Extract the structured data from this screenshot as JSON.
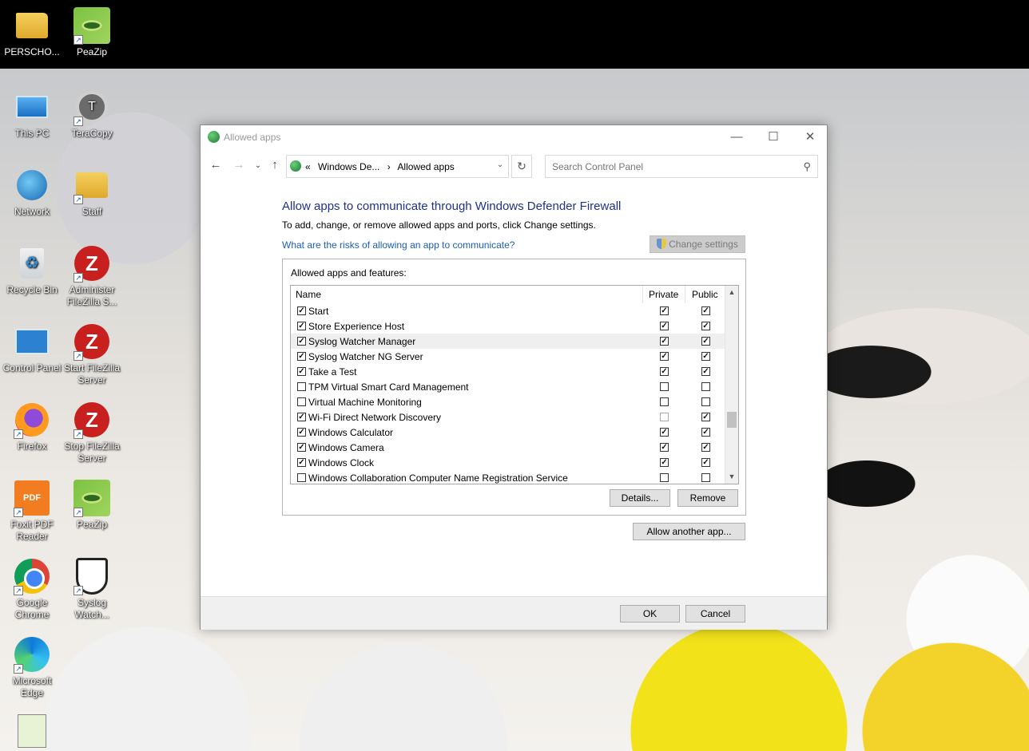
{
  "desktop": {
    "icons": [
      {
        "label": "PERSCHO...",
        "icon": "user-folder-icon"
      },
      {
        "label": "PeaZip",
        "icon": "peazip-icon"
      },
      {
        "label": "This PC",
        "icon": "computer-icon"
      },
      {
        "label": "TeraCopy",
        "icon": "teracopy-icon"
      },
      {
        "label": "Network",
        "icon": "network-icon"
      },
      {
        "label": "Staff",
        "icon": "folder-icon"
      },
      {
        "label": "Recycle Bin",
        "icon": "recycle-bin-icon"
      },
      {
        "label": "Administer FileZilla S...",
        "icon": "filezilla-icon"
      },
      {
        "label": "Control Panel",
        "icon": "control-panel-icon"
      },
      {
        "label": "Start FileZilla Server",
        "icon": "filezilla-icon"
      },
      {
        "label": "Firefox",
        "icon": "firefox-icon"
      },
      {
        "label": "Stop FileZilla Server",
        "icon": "filezilla-icon"
      },
      {
        "label": "Foxit PDF Reader",
        "icon": "foxit-icon"
      },
      {
        "label": "PeaZip",
        "icon": "peazip-icon"
      },
      {
        "label": "Google Chrome",
        "icon": "chrome-icon"
      },
      {
        "label": "Syslog Watch...",
        "icon": "syslog-watcher-icon"
      },
      {
        "label": "Microsoft Edge",
        "icon": "edge-icon"
      },
      {
        "label": "",
        "icon": "notepad-icon"
      }
    ],
    "fz_glyph": "Z",
    "foxit_glyph": "PDF",
    "tera_glyph": "T",
    "recycle_glyph": "♻"
  },
  "window": {
    "title": "Allowed apps",
    "minimize_glyph": "—",
    "maximize_glyph": "☐",
    "close_glyph": "✕"
  },
  "address": {
    "back_glyph": "←",
    "forward_glyph": "→",
    "recent_glyph": "⌄",
    "up_glyph": "↑",
    "chevron": "«",
    "crumb1": "Windows De...",
    "sep": "›",
    "crumb2": "Allowed apps",
    "dropdown_glyph": "⌄",
    "refresh_glyph": "↻",
    "search_placeholder": "Search Control Panel",
    "search_glyph": "⚲"
  },
  "main": {
    "heading": "Allow apps to communicate through Windows Defender Firewall",
    "subtext": "To add, change, or remove allowed apps and ports, click Change settings.",
    "risk_link": "What are the risks of allowing an app to communicate?",
    "change_settings": "Change settings",
    "group_label": "Allowed apps and features:",
    "columns": {
      "name": "Name",
      "private": "Private",
      "public": "Public"
    },
    "apps": [
      {
        "name": "Start",
        "enabled": true,
        "private": true,
        "public": true
      },
      {
        "name": "Store Experience Host",
        "enabled": true,
        "private": true,
        "public": true
      },
      {
        "name": "Syslog Watcher Manager",
        "enabled": true,
        "private": true,
        "public": true,
        "highlighted": true
      },
      {
        "name": "Syslog Watcher NG Server",
        "enabled": true,
        "private": true,
        "public": true
      },
      {
        "name": "Take a Test",
        "enabled": true,
        "private": true,
        "public": true
      },
      {
        "name": "TPM Virtual Smart Card Management",
        "enabled": false,
        "private": false,
        "public": false
      },
      {
        "name": "Virtual Machine Monitoring",
        "enabled": false,
        "private": false,
        "public": false
      },
      {
        "name": "Wi-Fi Direct Network Discovery",
        "enabled": true,
        "private": false,
        "public": true,
        "private_dim": true
      },
      {
        "name": "Windows Calculator",
        "enabled": true,
        "private": true,
        "public": true
      },
      {
        "name": "Windows Camera",
        "enabled": true,
        "private": true,
        "public": true
      },
      {
        "name": "Windows Clock",
        "enabled": true,
        "private": true,
        "public": true
      },
      {
        "name": "Windows Collaboration Computer Name Registration Service",
        "enabled": false,
        "private": false,
        "public": false
      }
    ],
    "check_glyph": "✓",
    "scroll_up_glyph": "▲",
    "scroll_down_glyph": "▼",
    "details_button": "Details...",
    "remove_button": "Remove",
    "allow_another_button": "Allow another app..."
  },
  "footer": {
    "ok": "OK",
    "cancel": "Cancel"
  }
}
